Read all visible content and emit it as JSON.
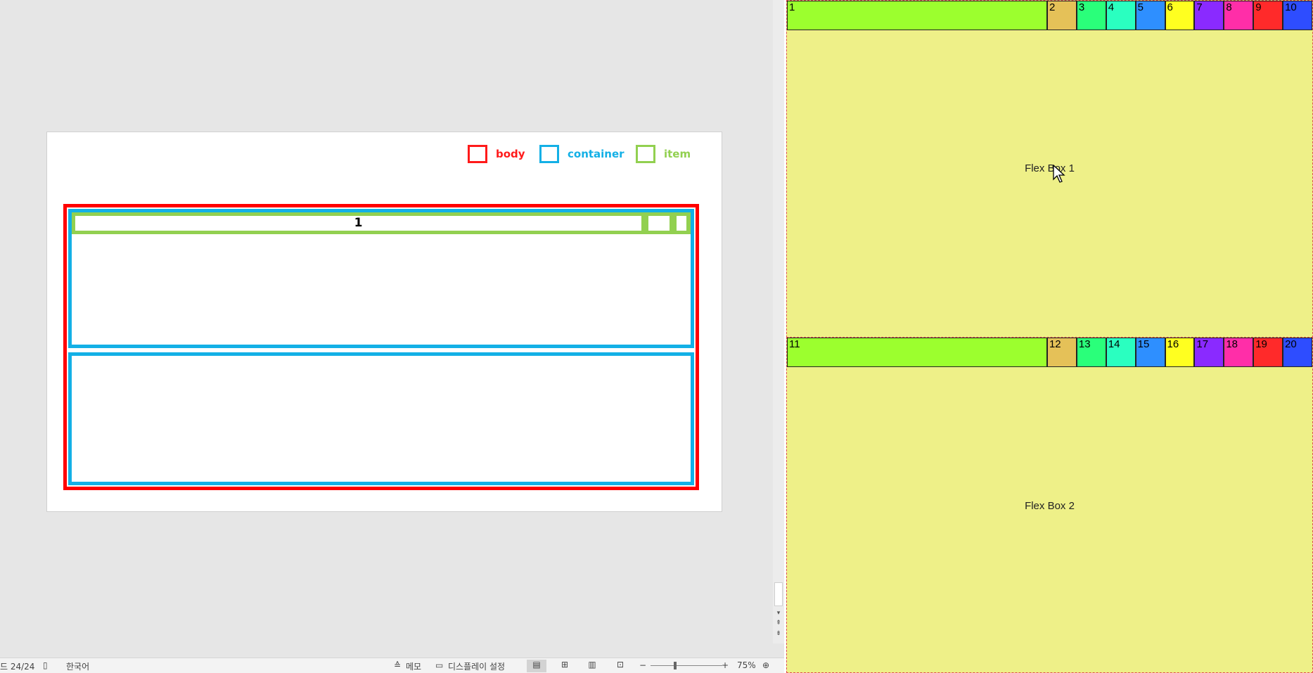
{
  "presentation": {
    "legend": [
      {
        "label": "body",
        "color": "#ff1a1a"
      },
      {
        "label": "container",
        "color": "#13b0e6"
      },
      {
        "label": "item",
        "color": "#92d050"
      }
    ],
    "diagram": {
      "item1_label": "1"
    }
  },
  "statusbar": {
    "slide_counter": "드 24/24",
    "language": "한국어",
    "notes_label": "메모",
    "display_settings_label": "디스플레이 설정",
    "zoom_minus": "−",
    "zoom_plus": "+",
    "zoom_level": "75%"
  },
  "browser": {
    "flexbox1": {
      "label": "Flex Box 1",
      "items": [
        {
          "n": "1",
          "color": "#9cff2e"
        },
        {
          "n": "2",
          "color": "#e5c158"
        },
        {
          "n": "3",
          "color": "#2aff7a"
        },
        {
          "n": "4",
          "color": "#2affc0"
        },
        {
          "n": "5",
          "color": "#2e8fff"
        },
        {
          "n": "6",
          "color": "#ffff20"
        },
        {
          "n": "7",
          "color": "#8a2aff"
        },
        {
          "n": "8",
          "color": "#ff2ea8"
        },
        {
          "n": "9",
          "color": "#ff2a2a"
        },
        {
          "n": "10",
          "color": "#2e4dff"
        }
      ]
    },
    "flexbox2": {
      "label": "Flex Box 2",
      "items": [
        {
          "n": "11",
          "color": "#9cff2e"
        },
        {
          "n": "12",
          "color": "#e5c158"
        },
        {
          "n": "13",
          "color": "#2aff7a"
        },
        {
          "n": "14",
          "color": "#2affc0"
        },
        {
          "n": "15",
          "color": "#2e8fff"
        },
        {
          "n": "16",
          "color": "#ffff20"
        },
        {
          "n": "17",
          "color": "#8a2aff"
        },
        {
          "n": "18",
          "color": "#ff2ea8"
        },
        {
          "n": "19",
          "color": "#ff2a2a"
        },
        {
          "n": "20",
          "color": "#2e4dff"
        }
      ]
    }
  }
}
